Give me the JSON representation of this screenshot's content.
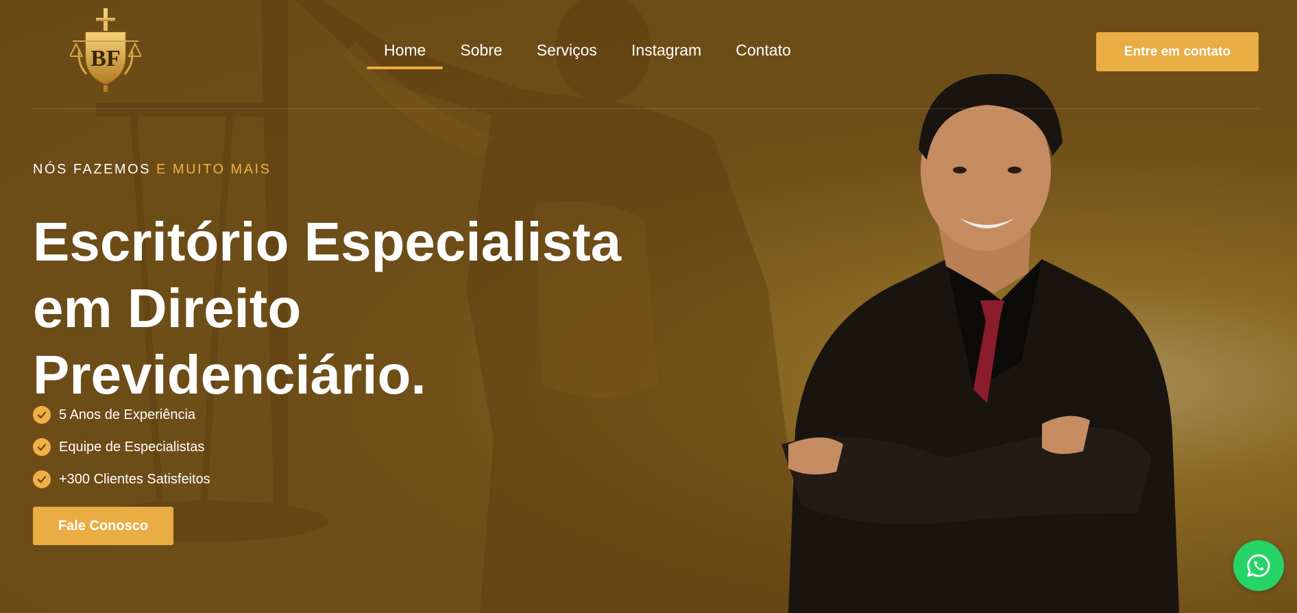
{
  "brand": {
    "logo_text": "BF",
    "accent_color": "#e9ad43",
    "whatsapp_color": "#25d366"
  },
  "nav": {
    "items": [
      {
        "label": "Home",
        "active": true
      },
      {
        "label": "Sobre",
        "active": false
      },
      {
        "label": "Serviços",
        "active": false
      },
      {
        "label": "Instagram",
        "active": false
      },
      {
        "label": "Contato",
        "active": false
      }
    ],
    "cta_label": "Entre em contato"
  },
  "hero": {
    "eyebrow_primary": "NÓS FAZEMOS",
    "eyebrow_accent": "E MUITO MAIS",
    "title_lines": [
      "Escritório Especialista",
      "em Direito",
      "Previdenciário."
    ],
    "features": [
      "5 Anos de Experiência",
      "Equipe de Especialistas",
      "+300 Clientes Satisfeitos"
    ],
    "cta_label": "Fale Conosco"
  },
  "icons": {
    "feature_icon": "check-circle-icon",
    "floating_button_icon": "whatsapp-icon"
  }
}
